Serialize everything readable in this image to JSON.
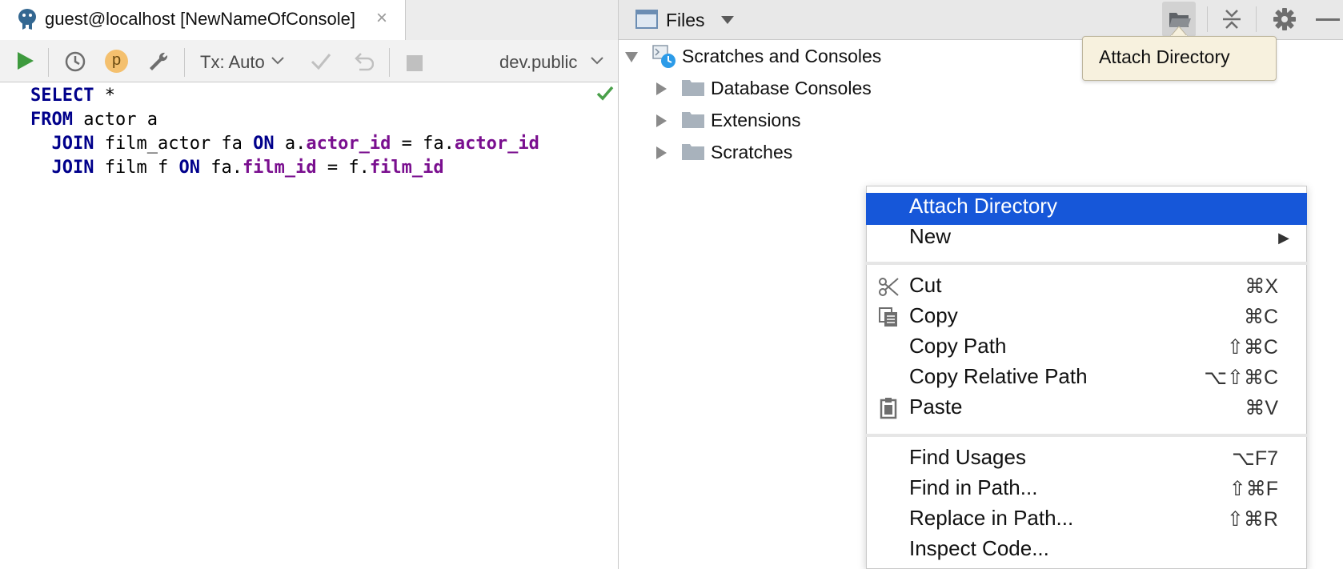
{
  "console_tab": {
    "title": "guest@localhost [NewNameOfConsole]",
    "close": "×"
  },
  "toolbar": {
    "p_label": "p",
    "tx_label": "Tx: Auto",
    "schema_label": "dev.public"
  },
  "editor": {
    "lines": [
      [
        {
          "t": "SELECT",
          "c": "kw"
        },
        {
          "t": " *",
          "c": ""
        }
      ],
      [
        {
          "t": "FROM",
          "c": "kw"
        },
        {
          "t": " actor a",
          "c": ""
        }
      ],
      [
        {
          "t": "  JOIN",
          "c": "kw"
        },
        {
          "t": " film_actor fa ",
          "c": ""
        },
        {
          "t": "ON",
          "c": "kw"
        },
        {
          "t": " a.",
          "c": ""
        },
        {
          "t": "actor_id",
          "c": "fld"
        },
        {
          "t": " = fa.",
          "c": ""
        },
        {
          "t": "actor_id",
          "c": "fld"
        }
      ],
      [
        {
          "t": "  JOIN",
          "c": "kw"
        },
        {
          "t": " film f ",
          "c": ""
        },
        {
          "t": "ON",
          "c": "kw"
        },
        {
          "t": " fa.",
          "c": ""
        },
        {
          "t": "film_id",
          "c": "fld"
        },
        {
          "t": " = f.",
          "c": ""
        },
        {
          "t": "film_id",
          "c": "fld"
        }
      ]
    ]
  },
  "files_panel": {
    "title": "Files",
    "tooltip": "Attach Directory",
    "tree": {
      "root": "Scratches and Consoles",
      "children": [
        "Database Consoles",
        "Extensions",
        "Scratches"
      ]
    }
  },
  "context_menu": {
    "items": [
      {
        "label": "Attach Directory",
        "shortcut": "",
        "icon": "",
        "highlighted": true
      },
      {
        "label": "New",
        "shortcut": "▶",
        "icon": "",
        "highlighted": false
      },
      {
        "label": "Cut",
        "shortcut": "⌘X",
        "icon": "scissors-icon",
        "highlighted": false
      },
      {
        "label": "Copy",
        "shortcut": "⌘C",
        "icon": "copy-icon",
        "highlighted": false
      },
      {
        "label": "Copy Path",
        "shortcut": "⇧⌘C",
        "icon": "",
        "highlighted": false
      },
      {
        "label": "Copy Relative Path",
        "shortcut": "⌥⇧⌘C",
        "icon": "",
        "highlighted": false
      },
      {
        "label": "Paste",
        "shortcut": "⌘V",
        "icon": "clipboard-icon",
        "highlighted": false
      },
      {
        "label": "Find Usages",
        "shortcut": "⌥F7",
        "icon": "",
        "highlighted": false
      },
      {
        "label": "Find in Path...",
        "shortcut": "⇧⌘F",
        "icon": "",
        "highlighted": false
      },
      {
        "label": "Replace in Path...",
        "shortcut": "⇧⌘R",
        "icon": "",
        "highlighted": false
      },
      {
        "label": "Inspect Code...",
        "shortcut": "",
        "icon": "",
        "highlighted": false
      }
    ]
  },
  "colors": {
    "selection": "#1657d9",
    "keyword": "#00008b",
    "field": "#7a0f8f",
    "run_green": "#3e9a3e",
    "tooltip_bg": "#f7f1de"
  }
}
